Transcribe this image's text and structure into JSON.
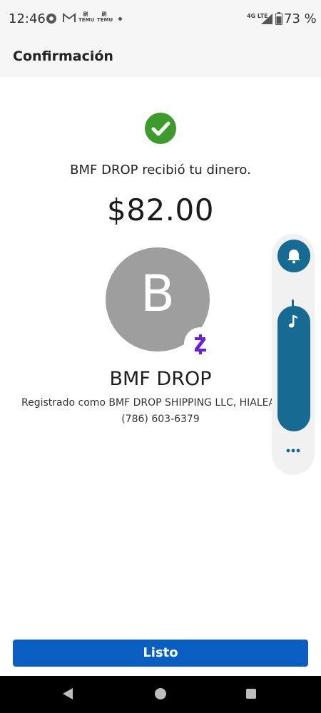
{
  "status_bar": {
    "time": "12:46",
    "notification_icons": [
      "chat-bubble-icon",
      "gmail-icon",
      "temu-icon",
      "temu-icon"
    ],
    "temu_label_1": "刷 TEMU",
    "temu_label_2": "刷 TEMU",
    "network_label": "4G LTE",
    "battery_percent": "73 %"
  },
  "header": {
    "title": "Confirmación"
  },
  "confirmation": {
    "status_icon": "check-circle-icon",
    "message": "BMF DROP recibió tu dinero.",
    "amount": "$82.00"
  },
  "recipient": {
    "avatar_letter": "B",
    "badge_icon": "zelle-icon",
    "name": "BMF DROP",
    "registered_as": "Registrado como BMF DROP SHIPPING LLC, HIALEAH",
    "phone": "(786) 603-6379"
  },
  "side_panel": {
    "icons": [
      "bell-icon",
      "music-note-icon",
      "more-horizontal-icon"
    ]
  },
  "actions": {
    "done_label": "Listo"
  },
  "colors": {
    "success_green": "#3d9a2b",
    "primary_blue": "#0b5ec1",
    "zelle_purple": "#6d1ed4",
    "panel_teal": "#176a91",
    "avatar_gray": "#9e9e9e"
  }
}
